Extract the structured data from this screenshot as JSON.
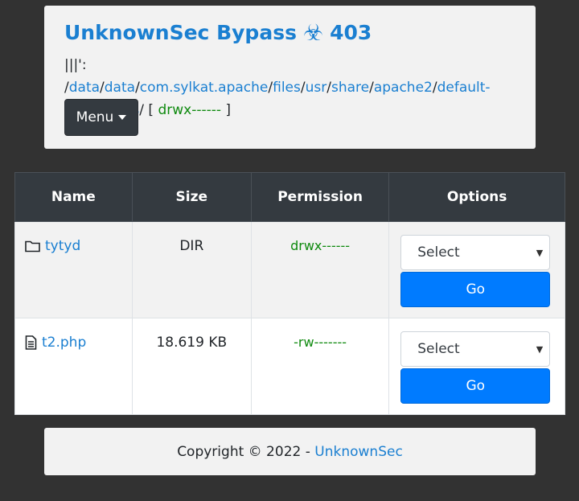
{
  "header": {
    "title": "UnknownSec Bypass",
    "title_suffix": "403",
    "path_prefix_icon": "|||'",
    "path_sep": ":",
    "path_segments": [
      "data",
      "data",
      "com.sylkat.apache",
      "files",
      "usr",
      "share",
      "apache2",
      "default-site",
      "htdocs"
    ],
    "path_permission": "drwx------",
    "menu_label": "Menu"
  },
  "table": {
    "headers": [
      "Name",
      "Size",
      "Permission",
      "Options"
    ],
    "rows": [
      {
        "icon": "folder-icon",
        "name": "tytyd",
        "size": "DIR",
        "permission": "drwx------",
        "select": "Select",
        "go": "Go"
      },
      {
        "icon": "file-icon",
        "name": "t2.php",
        "size": "18.619 KB",
        "permission": "-rw-------",
        "select": "Select",
        "go": "Go"
      }
    ]
  },
  "footer": {
    "text": "Copyright © 2022 -",
    "link": "UnknownSec"
  }
}
